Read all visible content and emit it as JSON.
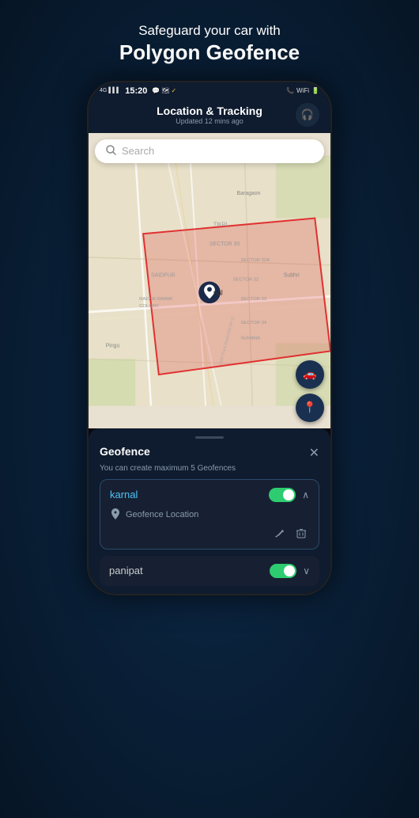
{
  "page": {
    "headline_sub": "Safeguard your car with",
    "headline_main": "Polygon Geofence"
  },
  "status_bar": {
    "signal": "4G",
    "time": "15:20",
    "icons_left": "📶 📶",
    "battery": "🔋",
    "wifi": "📶"
  },
  "header": {
    "title": "Location & Tracking",
    "subtitle": "Updated 12 mins ago",
    "headphone_icon": "🎧"
  },
  "search": {
    "placeholder": "Search",
    "icon": "🔍"
  },
  "fab": {
    "car_icon": "🚗",
    "pin_icon": "📍"
  },
  "panel": {
    "drag_handle": true,
    "title": "Geofence",
    "close_icon": "✕",
    "subtitle": "You can create maximum 5 Geofences",
    "geofences": [
      {
        "name": "karnal",
        "enabled": true,
        "expanded": true,
        "location_label": "Geofence Location"
      },
      {
        "name": "panipat",
        "enabled": true,
        "expanded": false
      }
    ]
  },
  "icons": {
    "search": "⌕",
    "close": "✕",
    "pin": "⚲",
    "edit": "✎",
    "trash": "🗑",
    "chevron_up": "∧",
    "chevron_down": "∨",
    "headphones": "🎧",
    "car": "🚙"
  }
}
